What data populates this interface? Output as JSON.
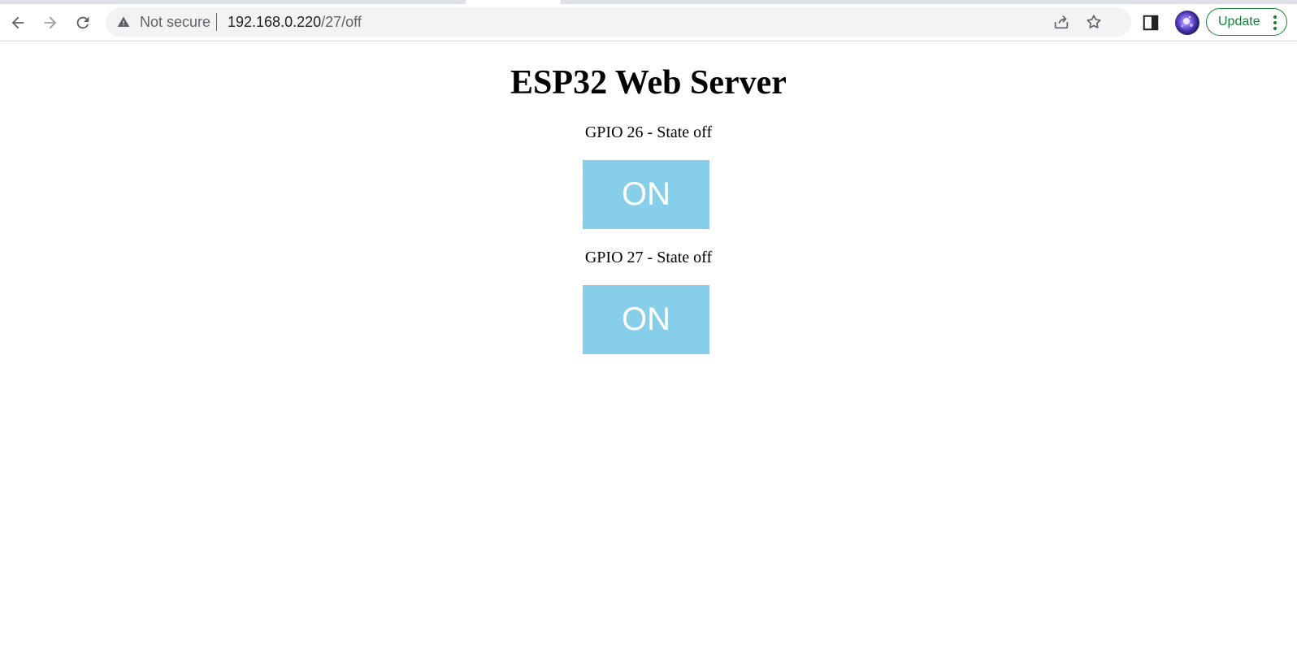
{
  "browser": {
    "omnibox": {
      "security_label": "Not secure",
      "url_host": "192.168.0.220",
      "url_path": "/27/off"
    },
    "update_label": "Update"
  },
  "page": {
    "title": "ESP32 Web Server",
    "gpios": [
      {
        "label": "GPIO 26 - State off",
        "button_label": "ON"
      },
      {
        "label": "GPIO 27 - State off",
        "button_label": "ON"
      }
    ],
    "button_color": "#87ceeb"
  }
}
